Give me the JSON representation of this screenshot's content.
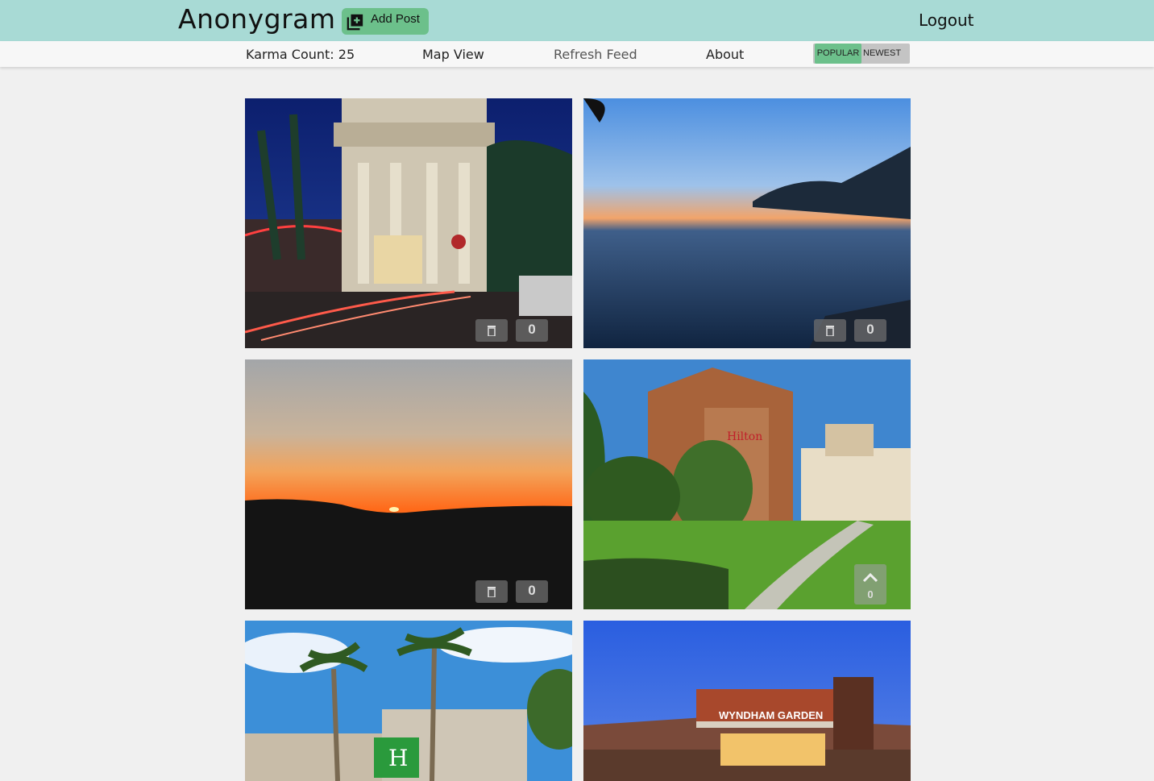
{
  "header": {
    "logo": "Anonygram",
    "add_post_label": "Add Post",
    "logout_label": "Logout"
  },
  "nav": {
    "karma": "Karma Count: 25",
    "map_view": "Map View",
    "refresh": "Refresh Feed",
    "about": "About",
    "sort_options": [
      "POPULAR",
      "NEWEST"
    ],
    "sort_selected": "POPULAR"
  },
  "posts": [
    {
      "scene": "town-hall-night",
      "votes": "0",
      "controls": "trash-and-count"
    },
    {
      "scene": "sea-sunset",
      "votes": "0",
      "controls": "trash-and-count"
    },
    {
      "scene": "orange-sunset",
      "votes": "0",
      "controls": "trash-and-count"
    },
    {
      "scene": "hilton-hotel",
      "votes": "0",
      "controls": "upvote"
    },
    {
      "scene": "holiday-inn-palms",
      "votes": "",
      "controls": "none"
    },
    {
      "scene": "wyndham-garden-dusk",
      "votes": "",
      "controls": "none"
    }
  ],
  "colors": {
    "header_bg": "#a8dad5",
    "accent_green": "#6cc08b",
    "page_bg": "#f0f0f0"
  },
  "icons": [
    "add-post-icon",
    "trash-icon",
    "chevron-up-icon"
  ]
}
